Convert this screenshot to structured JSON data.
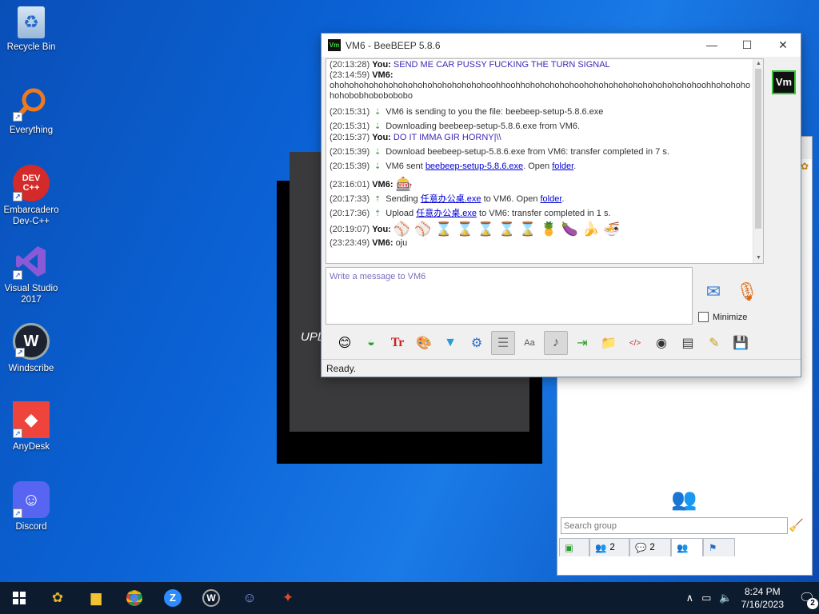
{
  "desktop": {
    "icons": [
      {
        "label": "Recycle Bin",
        "glyph": "♻"
      },
      {
        "label": "Everything",
        "glyph": "○"
      },
      {
        "label": "Embarcadero Dev-C++",
        "glyph": "DEV C++"
      },
      {
        "label": "Visual Studio 2017",
        "glyph": "⋈"
      },
      {
        "label": "Windscribe",
        "glyph": "W"
      },
      {
        "label": "AnyDesk",
        "glyph": "◇"
      },
      {
        "label": "Discord",
        "glyph": "☺"
      }
    ],
    "background_window_text": "UPD",
    "accent_color": "#0b63d6"
  },
  "chat_window": {
    "title": "VM6 - BeeBEEP 5.8.6",
    "controls": {
      "minimize": "—",
      "maximize": "☐",
      "close": "✕"
    },
    "avatar": "Vm",
    "messages": {
      "m1": {
        "time": "(20:13:28)",
        "sender": "You:",
        "text": "SEND ME CAR PUSSY FUCKING THE TURN SIGNAL"
      },
      "m2": {
        "time": "(23:14:59)",
        "sender": "VM6:",
        "text": "ohohohohohohohohohohohohohohohohoohhoohhohohohohohoohohohohohohohohohohohohoohhohohohohohobobhobobobobo"
      },
      "m3": {
        "time": "(20:15:31)",
        "text": "VM6 is sending to you the file: beebeep-setup-5.8.6.exe"
      },
      "m4": {
        "time": "(20:15:31)",
        "text": "Downloading beebeep-setup-5.8.6.exe from VM6."
      },
      "m5": {
        "time": "(20:15:37)",
        "sender": "You:",
        "text": "DO IT IMMA GIR HORNY|\\\\"
      },
      "m6": {
        "time": "(20:15:39)",
        "text": "Download beebeep-setup-5.8.6.exe from VM6: transfer completed in 7 s."
      },
      "m7": {
        "time": "(20:15:39)",
        "prefix": "VM6 sent ",
        "link": "beebeep-setup-5.8.6.exe",
        "mid": ". Open ",
        "link2": "folder",
        "suffix": "."
      },
      "m8": {
        "time": "(23:16:01)",
        "sender": "VM6:",
        "emoji": "🎰"
      },
      "m9": {
        "time": "(20:17:33)",
        "prefix": "Sending ",
        "link": "任意办公桌.exe",
        "mid": " to VM6. Open ",
        "link2": "folder",
        "suffix": "."
      },
      "m10": {
        "time": "(20:17:36)",
        "prefix": "Upload ",
        "link": "任意办公桌.exe",
        "suffix": " to VM6: transfer completed in 1 s."
      },
      "m11": {
        "time": "(20:19:07)",
        "sender": "You:",
        "emojis": [
          "⚾",
          "⚾",
          "⌛",
          "⌛",
          "⌛",
          "⌛",
          "⌛",
          "🍍",
          "🍆",
          "🍌",
          "🍜"
        ]
      },
      "m12": {
        "time": "(23:23:49)",
        "sender": "VM6:",
        "text": "oju"
      }
    },
    "compose_placeholder": "Write a message to VM6",
    "minimize_label": "Minimize",
    "status": "Ready."
  },
  "main_window": {
    "search_placeholder": "Search group",
    "tabs": [
      {
        "icon": "▣",
        "count": ""
      },
      {
        "icon": "👥",
        "count": "2"
      },
      {
        "icon": "💬",
        "count": "2"
      },
      {
        "icon": "👥",
        "count": ""
      },
      {
        "icon": "⚑",
        "count": ""
      }
    ]
  },
  "taskbar": {
    "time": "8:24 PM",
    "date": "7/16/2023",
    "notification_count": "2"
  }
}
